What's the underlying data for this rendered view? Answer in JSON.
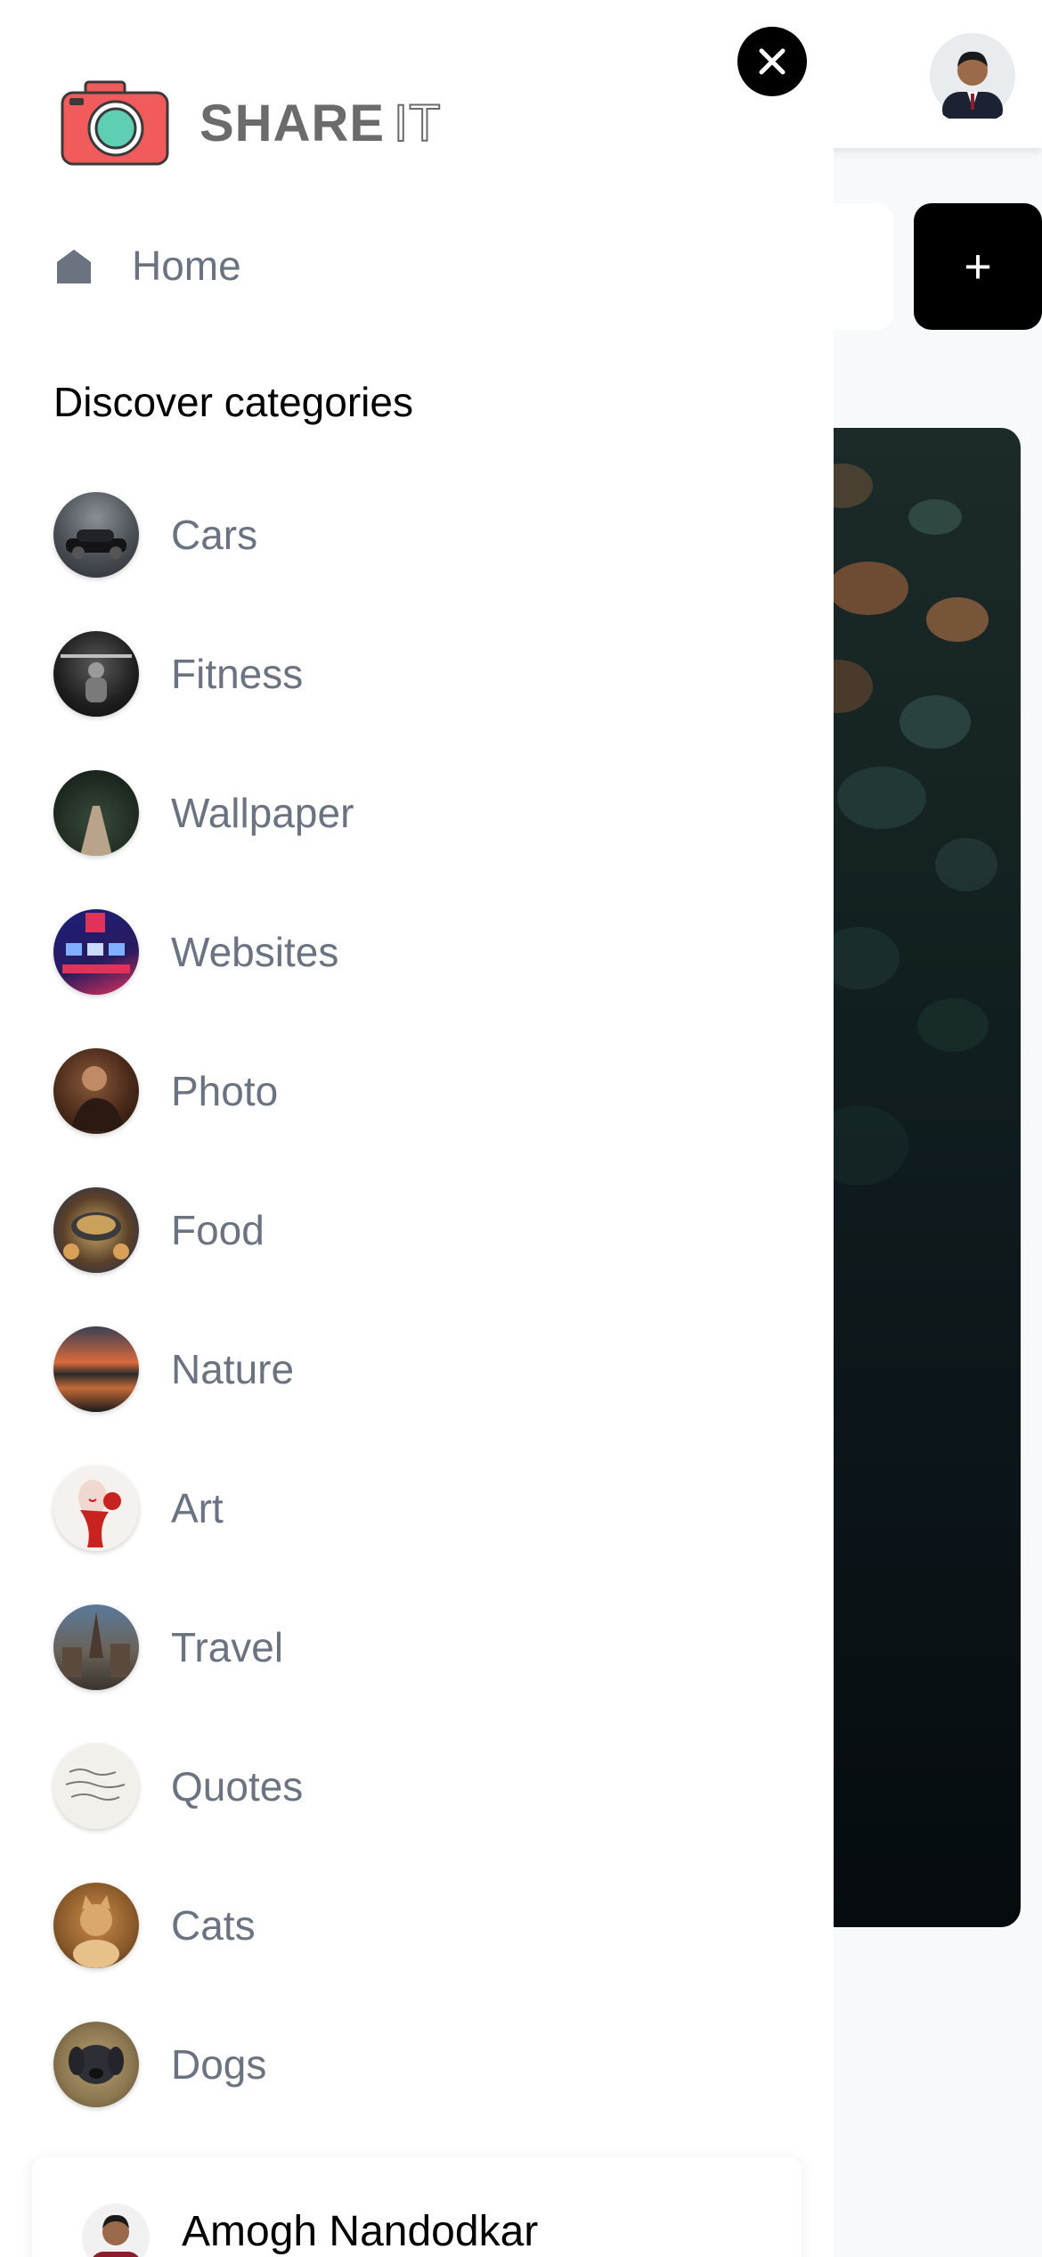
{
  "app": {
    "logo_main": "SHARE",
    "logo_suffix": "IT"
  },
  "nav": {
    "home_label": "Home"
  },
  "categories_section": {
    "title": "Discover categories",
    "items": [
      {
        "label": "Cars"
      },
      {
        "label": "Fitness"
      },
      {
        "label": "Wallpaper"
      },
      {
        "label": "Websites"
      },
      {
        "label": "Photo"
      },
      {
        "label": "Food"
      },
      {
        "label": "Nature"
      },
      {
        "label": "Art"
      },
      {
        "label": "Travel"
      },
      {
        "label": "Quotes"
      },
      {
        "label": "Cats"
      },
      {
        "label": "Dogs"
      }
    ]
  },
  "user": {
    "name": "Amogh Nandodkar"
  },
  "toolbar": {
    "add_label": "+"
  },
  "colors": {
    "accent": "#000000",
    "logo_camera": "#f15b5b",
    "logo_lens": "#5fcfb4",
    "muted_text": "#6b7280"
  },
  "icons": {
    "close": "close-icon",
    "home": "home-icon",
    "add": "plus-icon",
    "camera": "camera-logo-icon"
  }
}
